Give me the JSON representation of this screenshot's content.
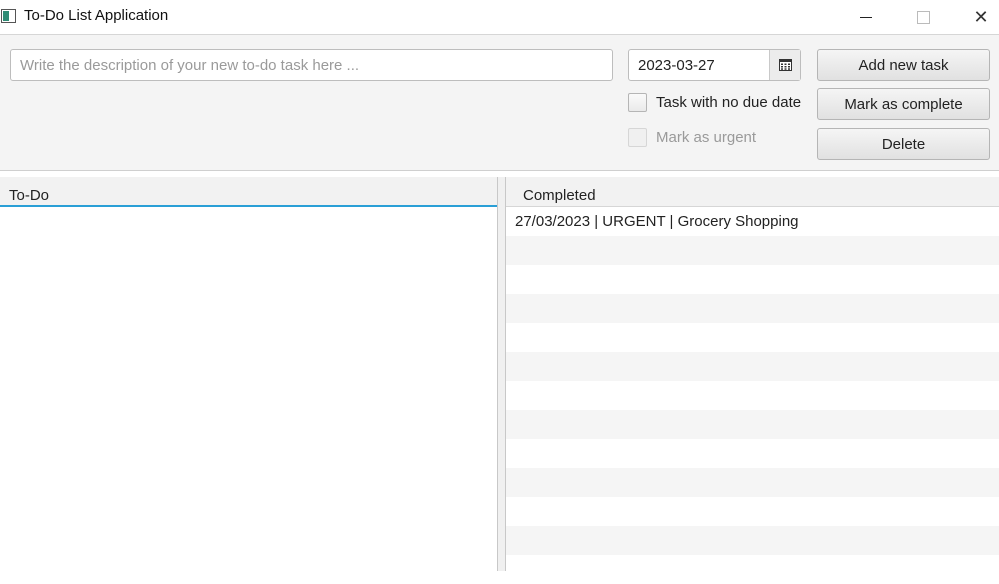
{
  "window": {
    "title": "To-Do List Application",
    "icon": "app-icon",
    "controls": {
      "minimize": "minimize-icon",
      "maximize": "maximize-icon",
      "close": "✕"
    }
  },
  "toolbar": {
    "description_placeholder": "Write the description of your new to-do task here ...",
    "description_value": "",
    "date_value": "2023-03-27",
    "calendar_icon": "calendar-icon",
    "add_label": "Add new task",
    "complete_label": "Mark as complete",
    "delete_label": "Delete",
    "no_due_label": "Task with no due date",
    "urgent_label": "Mark as urgent"
  },
  "todo": {
    "header": "To-Do",
    "items": []
  },
  "completed": {
    "header": "Completed",
    "items": [
      "27/03/2023 | URGENT | Grocery Shopping"
    ]
  },
  "colors": {
    "accent": "#2a9fd6",
    "toolbar_bg": "#f4f4f4",
    "row_alt": "#f5f5f5"
  }
}
